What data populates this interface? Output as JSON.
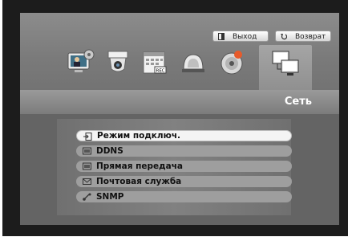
{
  "topbar": {
    "exit_label": "Выход",
    "back_label": "Возврат"
  },
  "icons": [
    {
      "name": "system-settings-icon"
    },
    {
      "name": "camera-icon"
    },
    {
      "name": "record-schedule-icon",
      "badge": "REC"
    },
    {
      "name": "event-alarm-icon"
    },
    {
      "name": "backup-disc-icon"
    },
    {
      "name": "network-icon",
      "selected": true
    }
  ],
  "section": {
    "title": "Сеть"
  },
  "menu": {
    "items": [
      {
        "label": "Режим подключ.",
        "icon": "connection-mode-icon",
        "active": true
      },
      {
        "label": "DDNS",
        "icon": "ddns-icon"
      },
      {
        "label": "Прямая передача",
        "icon": "live-transfer-icon"
      },
      {
        "label": "Почтовая служба",
        "icon": "mail-icon"
      },
      {
        "label": "SNMP",
        "icon": "snmp-icon"
      }
    ]
  },
  "colors": {
    "frame": "#1c1c1c",
    "screen": "#6a6a6a",
    "active_item": "#f4f4f4",
    "item": "#9e9e9e"
  }
}
